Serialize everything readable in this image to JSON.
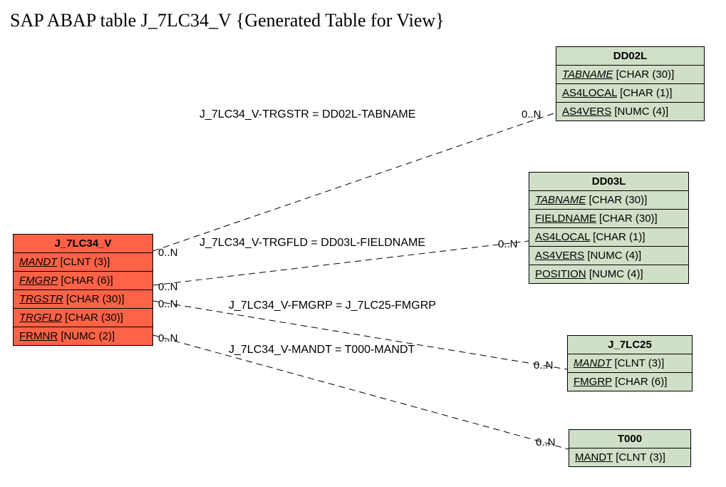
{
  "title": "SAP ABAP table J_7LC34_V {Generated Table for View}",
  "entities": {
    "main": {
      "name": "J_7LC34_V",
      "fields": [
        {
          "name": "MANDT",
          "type": "[CLNT (3)]",
          "ul": true,
          "it": true
        },
        {
          "name": "FMGRP",
          "type": "[CHAR (6)]",
          "ul": true,
          "it": true
        },
        {
          "name": "TRGSTR",
          "type": "[CHAR (30)]",
          "ul": true,
          "it": true
        },
        {
          "name": "TRGFLD",
          "type": "[CHAR (30)]",
          "ul": true,
          "it": true
        },
        {
          "name": "FRMNR",
          "type": "[NUMC (2)]",
          "ul": true,
          "it": false
        }
      ]
    },
    "dd02l": {
      "name": "DD02L",
      "fields": [
        {
          "name": "TABNAME",
          "type": "[CHAR (30)]",
          "ul": true,
          "it": true
        },
        {
          "name": "AS4LOCAL",
          "type": "[CHAR (1)]",
          "ul": true,
          "it": false
        },
        {
          "name": "AS4VERS",
          "type": "[NUMC (4)]",
          "ul": true,
          "it": false
        }
      ]
    },
    "dd03l": {
      "name": "DD03L",
      "fields": [
        {
          "name": "TABNAME",
          "type": "[CHAR (30)]",
          "ul": true,
          "it": true
        },
        {
          "name": "FIELDNAME",
          "type": "[CHAR (30)]",
          "ul": true,
          "it": false
        },
        {
          "name": "AS4LOCAL",
          "type": "[CHAR (1)]",
          "ul": true,
          "it": false
        },
        {
          "name": "AS4VERS",
          "type": "[NUMC (4)]",
          "ul": true,
          "it": false
        },
        {
          "name": "POSITION",
          "type": "[NUMC (4)]",
          "ul": true,
          "it": false
        }
      ]
    },
    "j7lc25": {
      "name": "J_7LC25",
      "fields": [
        {
          "name": "MANDT",
          "type": "[CLNT (3)]",
          "ul": true,
          "it": true
        },
        {
          "name": "FMGRP",
          "type": "[CHAR (6)]",
          "ul": true,
          "it": false
        }
      ]
    },
    "t000": {
      "name": "T000",
      "fields": [
        {
          "name": "MANDT",
          "type": "[CLNT (3)]",
          "ul": true,
          "it": false
        }
      ]
    }
  },
  "relations": [
    {
      "label": "J_7LC34_V-TRGSTR = DD02L-TABNAME",
      "leftCard": "0..N",
      "rightCard": "0..N"
    },
    {
      "label": "J_7LC34_V-TRGFLD = DD03L-FIELDNAME",
      "leftCard": "0..N",
      "rightCard": "0..N"
    },
    {
      "label": "J_7LC34_V-FMGRP = J_7LC25-FMGRP",
      "leftCard": "0..N",
      "rightCard": "0..N"
    },
    {
      "label": "J_7LC34_V-MANDT = T000-MANDT",
      "leftCard": "0..N",
      "rightCard": "0..N"
    }
  ]
}
